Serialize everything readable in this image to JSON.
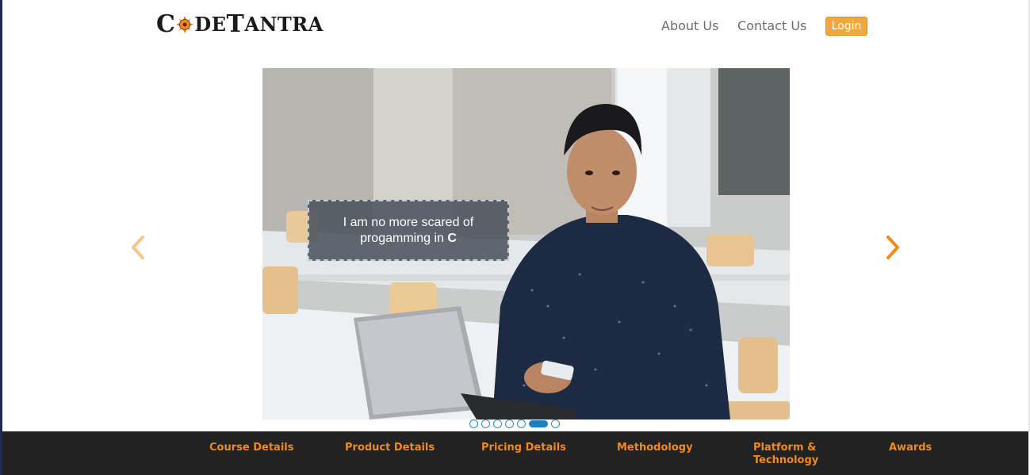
{
  "header": {
    "logo": {
      "part1": "C",
      "part2": "DE",
      "part3": "T",
      "part4": "ANTRA",
      "alt": "CodeTantra"
    },
    "nav": [
      {
        "label": "About Us"
      },
      {
        "label": "Contact Us"
      }
    ],
    "login_label": "Login"
  },
  "carousel": {
    "caption_line1": "I am no more scared of",
    "caption_line2_prefix": "progamming in ",
    "caption_line2_bold": "C",
    "slide_count": 7,
    "active_index": 5
  },
  "footer": {
    "links": [
      {
        "label": "Course Details"
      },
      {
        "label": "Product Details"
      },
      {
        "label": "Pricing Details"
      },
      {
        "label": "Methodology"
      },
      {
        "label": "Platform & Technology"
      },
      {
        "label": "Awards"
      }
    ]
  },
  "colors": {
    "accent_orange": "#f08a1c",
    "login_bg": "#f4a73a",
    "dot_blue": "#1f7fc4",
    "footer_bg": "#222222"
  }
}
